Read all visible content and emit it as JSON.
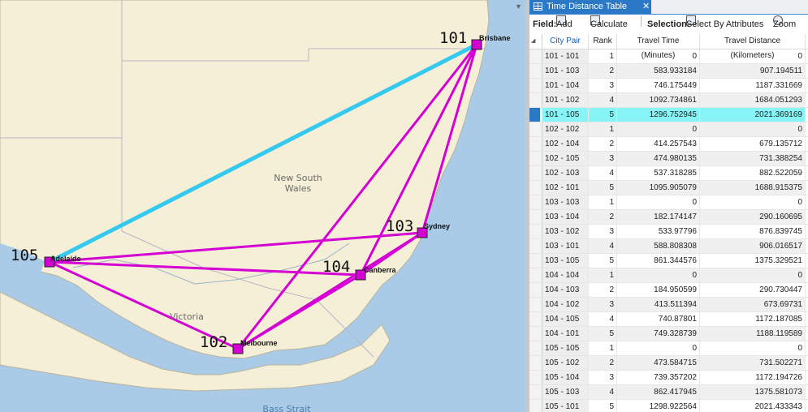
{
  "map": {
    "region_label": "New South\nWales",
    "victoria_label": "Victoria",
    "strait_label": "Bass Strait",
    "nodes": [
      {
        "id": "101",
        "city": "Brisbane"
      },
      {
        "id": "102",
        "city": "Melbourne"
      },
      {
        "id": "103",
        "city": "Sydney"
      },
      {
        "id": "104",
        "city": "Canberra"
      },
      {
        "id": "105",
        "city": "Adelaide"
      }
    ],
    "route_color": "#d400d4",
    "selected_route_color": "#35c9f0",
    "node_fill": "#d400d4"
  },
  "panel": {
    "tab_title": "Time Distance Table",
    "tab_close": "✕",
    "field_label": "Field:",
    "add_label": "Add",
    "calculate_label": "Calculate",
    "selection_label": "Selection:",
    "select_by_attributes_label": "Select By Attributes",
    "zoom_label": "Zoom",
    "columns": [
      "City Pair",
      "Rank",
      "Travel Time (Minutes)",
      "Travel Distance (Kilometers)"
    ],
    "rows": [
      {
        "pair": "101 - 101",
        "rank": "1",
        "time": "0",
        "dist": "0"
      },
      {
        "pair": "101 - 103",
        "rank": "2",
        "time": "583.933184",
        "dist": "907.194511"
      },
      {
        "pair": "101 - 104",
        "rank": "3",
        "time": "746.175449",
        "dist": "1187.331669"
      },
      {
        "pair": "101 - 102",
        "rank": "4",
        "time": "1092.734861",
        "dist": "1684.051293"
      },
      {
        "pair": "101 - 105",
        "rank": "5",
        "time": "1296.752945",
        "dist": "2021.369169"
      },
      {
        "pair": "102 - 102",
        "rank": "1",
        "time": "0",
        "dist": "0"
      },
      {
        "pair": "102 - 104",
        "rank": "2",
        "time": "414.257543",
        "dist": "679.135712"
      },
      {
        "pair": "102 - 105",
        "rank": "3",
        "time": "474.980135",
        "dist": "731.388254"
      },
      {
        "pair": "102 - 103",
        "rank": "4",
        "time": "537.318285",
        "dist": "882.522059"
      },
      {
        "pair": "102 - 101",
        "rank": "5",
        "time": "1095.905079",
        "dist": "1688.915375"
      },
      {
        "pair": "103 - 103",
        "rank": "1",
        "time": "0",
        "dist": "0"
      },
      {
        "pair": "103 - 104",
        "rank": "2",
        "time": "182.174147",
        "dist": "290.160695"
      },
      {
        "pair": "103 - 102",
        "rank": "3",
        "time": "533.97796",
        "dist": "876.839745"
      },
      {
        "pair": "103 - 101",
        "rank": "4",
        "time": "588.808308",
        "dist": "906.016517"
      },
      {
        "pair": "103 - 105",
        "rank": "5",
        "time": "861.344576",
        "dist": "1375.329521"
      },
      {
        "pair": "104 - 104",
        "rank": "1",
        "time": "0",
        "dist": "0"
      },
      {
        "pair": "104 - 103",
        "rank": "2",
        "time": "184.950599",
        "dist": "290.730447"
      },
      {
        "pair": "104 - 102",
        "rank": "3",
        "time": "413.511394",
        "dist": "673.69731"
      },
      {
        "pair": "104 - 105",
        "rank": "4",
        "time": "740.87801",
        "dist": "1172.187085"
      },
      {
        "pair": "104 - 101",
        "rank": "5",
        "time": "749.328739",
        "dist": "1188.119589"
      },
      {
        "pair": "105 - 105",
        "rank": "1",
        "time": "0",
        "dist": "0"
      },
      {
        "pair": "105 - 102",
        "rank": "2",
        "time": "473.584715",
        "dist": "731.502271"
      },
      {
        "pair": "105 - 104",
        "rank": "3",
        "time": "739.357202",
        "dist": "1172.194726"
      },
      {
        "pair": "105 - 103",
        "rank": "4",
        "time": "862.417945",
        "dist": "1375.581073"
      },
      {
        "pair": "105 - 101",
        "rank": "5",
        "time": "1298.922564",
        "dist": "2021.433343"
      }
    ],
    "selected_row_index": 4,
    "highlight_color": "#87f5f5"
  }
}
